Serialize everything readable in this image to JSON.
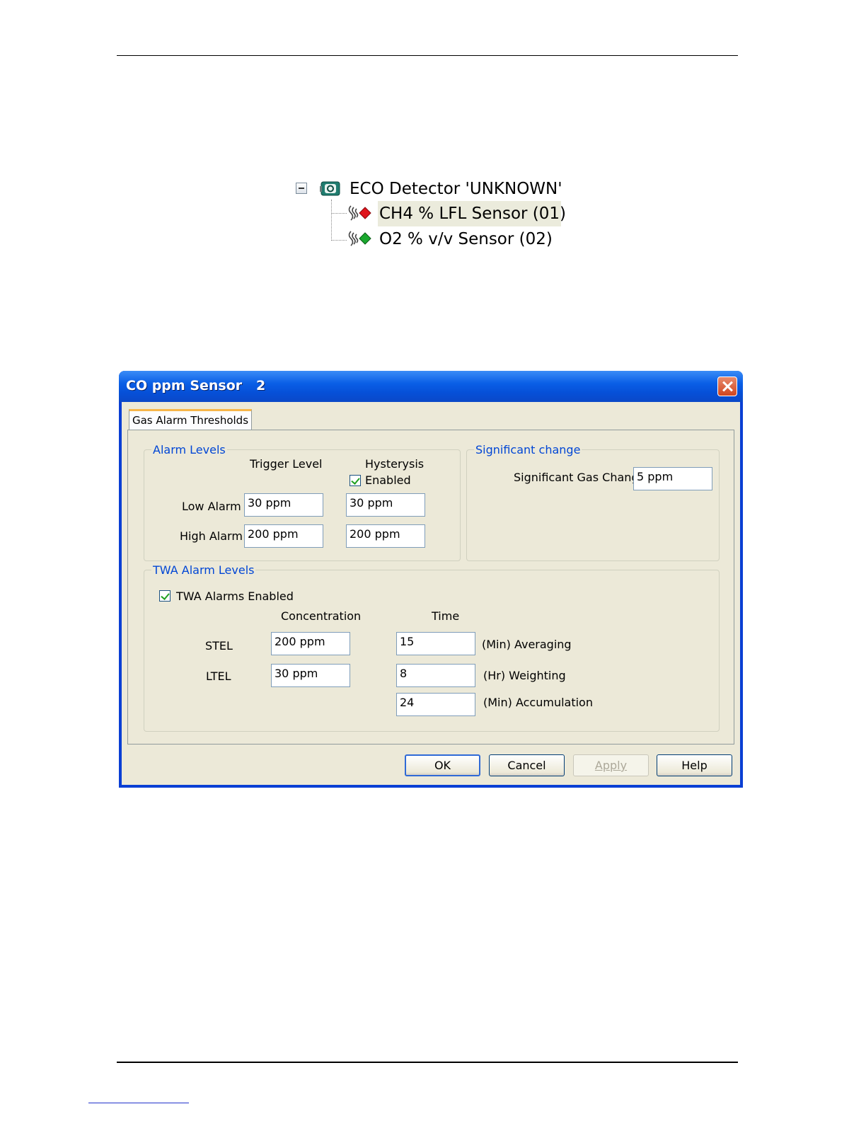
{
  "tree": {
    "detector_label": "ECO Detector 'UNKNOWN'",
    "sensors": [
      {
        "label": "CH4 % LFL Sensor (01)",
        "status_color": "#e0141c"
      },
      {
        "label": "O2 % v/v Sensor (02)",
        "status_color": "#1aa82e"
      }
    ]
  },
  "dialog": {
    "title": "CO ppm Sensor   2",
    "tab_label": "Gas Alarm Thresholds",
    "alarm_levels": {
      "legend": "Alarm Levels",
      "trigger_header": "Trigger Level",
      "hysteresis_header": "Hysterysis",
      "hysteresis_enabled_label": "Enabled",
      "hysteresis_enabled": true,
      "low_label": "Low Alarm",
      "high_label": "High Alarm",
      "low_trigger": "30 ppm",
      "low_hysteresis": "30 ppm",
      "high_trigger": "200 ppm",
      "high_hysteresis": "200 ppm"
    },
    "significant_change": {
      "legend": "Significant change",
      "label": "Significant Gas Change",
      "value": "5 ppm"
    },
    "twa": {
      "legend": "TWA Alarm Levels",
      "enabled_label": "TWA Alarms Enabled",
      "enabled": true,
      "concentration_header": "Concentration",
      "time_header": "Time",
      "stel_label": "STEL",
      "ltel_label": "LTEL",
      "stel_concentration": "200 ppm",
      "ltel_concentration": "30 ppm",
      "averaging_value": "15",
      "averaging_label": "(Min) Averaging",
      "weighting_value": "8",
      "weighting_label": "(Hr) Weighting",
      "accumulation_value": "24",
      "accumulation_label": "(Min) Accumulation"
    },
    "buttons": {
      "ok": "OK",
      "cancel": "Cancel",
      "apply": "Apply",
      "help": "Help"
    }
  }
}
